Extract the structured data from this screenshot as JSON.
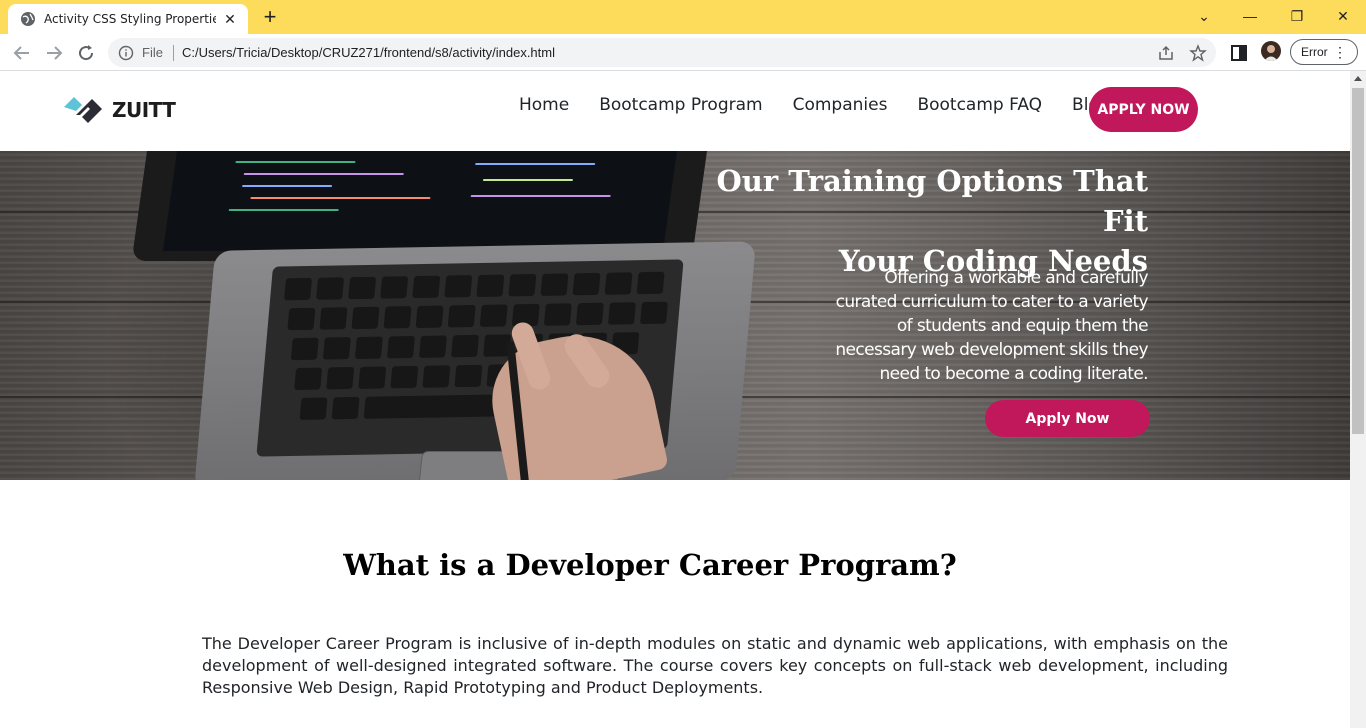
{
  "browser": {
    "tab_title": "Activity CSS Styling Properties and Positioning",
    "url_scheme_label": "File",
    "url": "C:/Users/Tricia/Desktop/CRUZ271/frontend/s8/activity/index.html",
    "error_label": "Error",
    "chrome_color": "#fddc5c"
  },
  "site": {
    "logo_text": "ZUITT",
    "nav": [
      {
        "label": "Home"
      },
      {
        "label": "Bootcamp Program"
      },
      {
        "label": "Companies"
      },
      {
        "label": "Bootcamp FAQ"
      },
      {
        "label": "Blog"
      }
    ],
    "apply_top_label": "APPLY NOW",
    "accent_color": "#c1185b"
  },
  "hero": {
    "title_line1": "Our Training Options That Fit",
    "title_line2": "Your Coding Needs",
    "text": "Offering a workable and carefully curated curriculum to cater to a variety of students and equip them the necessary web development skills they need to become a coding literate.",
    "button_label": "Apply Now"
  },
  "section": {
    "title": "What is a Developer Career Program?",
    "text": "The Developer Career Program is inclusive of in-depth modules on static and dynamic web applications, with emphasis on the development of well-designed integrated software. The course covers key concepts on full-stack web development, including Responsive Web Design, Rapid Prototyping and Product Deployments."
  }
}
